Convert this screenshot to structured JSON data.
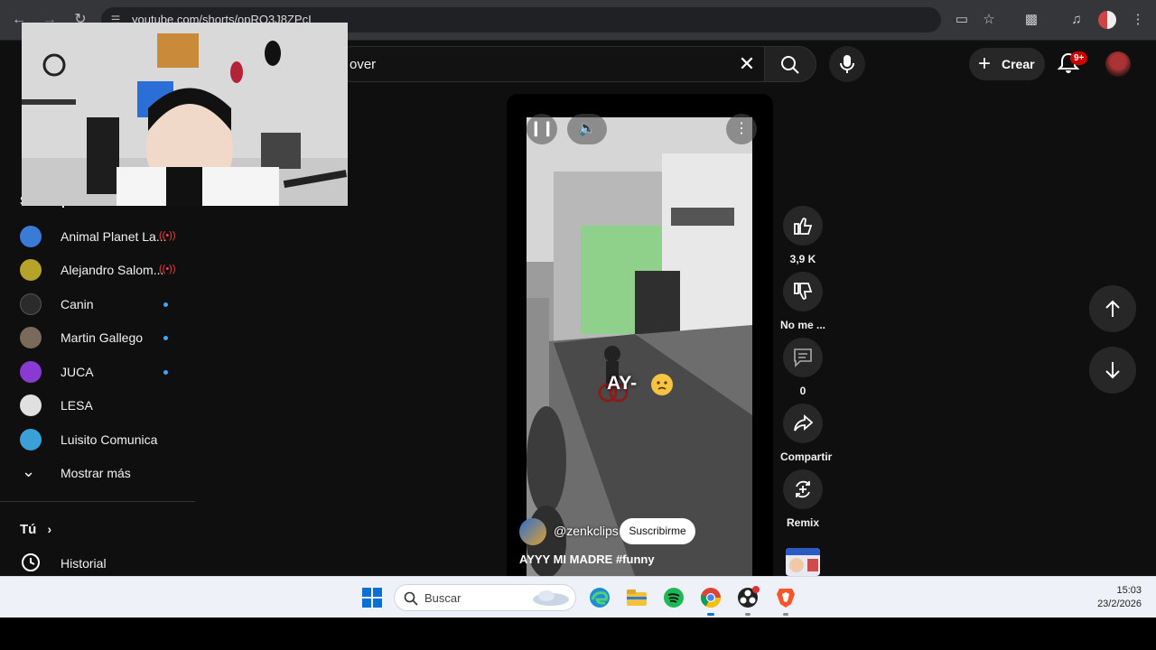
{
  "browser": {
    "url": "youtube.com/shorts/opRO3J8ZPcI",
    "icons": [
      "back-icon",
      "forward-icon",
      "reload-icon",
      "site-settings-icon",
      "install-icon",
      "star-icon",
      "extensions-icon",
      "media-icon",
      "profile-icon",
      "menu-icon"
    ]
  },
  "youtube": {
    "search_query": "over",
    "create_label": "Crear",
    "notifications_badge": "9+"
  },
  "sidebar": {
    "subscriptions_title": "Suscripciones",
    "subscriptions": [
      {
        "name": "Animal Planet La...",
        "status": "live",
        "color": "#3a7bd5"
      },
      {
        "name": "Alejandro Salom...",
        "status": "live",
        "color": "#b5a32a"
      },
      {
        "name": "Canin",
        "status": "new",
        "color": "#2b2b2b"
      },
      {
        "name": "Martin Gallego",
        "status": "new",
        "color": "#7a6a5a"
      },
      {
        "name": "JUCA",
        "status": "new",
        "color": "#8a3ad0"
      },
      {
        "name": "LESA",
        "status": "none",
        "color": "#e0e0e0"
      },
      {
        "name": "Luisito Comunica",
        "status": "none",
        "color": "#3aa0d8"
      }
    ],
    "show_more": "Mostrar más",
    "you_label": "Tú",
    "history_label": "Historial"
  },
  "short": {
    "overlay_text": "AY-",
    "channel": "@zenkclips",
    "subscribe_label": "Suscribirme",
    "title": "AYYY MI MADRE",
    "hashtag": "#funny"
  },
  "actions": {
    "likes": "3,9 K",
    "dislike_label": "No me ...",
    "comments": "0",
    "share_label": "Compartir",
    "remix_label": "Remix"
  },
  "taskbar": {
    "search_label": "Buscar",
    "time": "15:03",
    "date": "23/2/2026",
    "apps": [
      "windows-start-icon",
      "weather-icon",
      "edge-icon",
      "file-explorer-icon",
      "spotify-icon",
      "chrome-icon",
      "obs-icon",
      "brave-icon"
    ]
  }
}
